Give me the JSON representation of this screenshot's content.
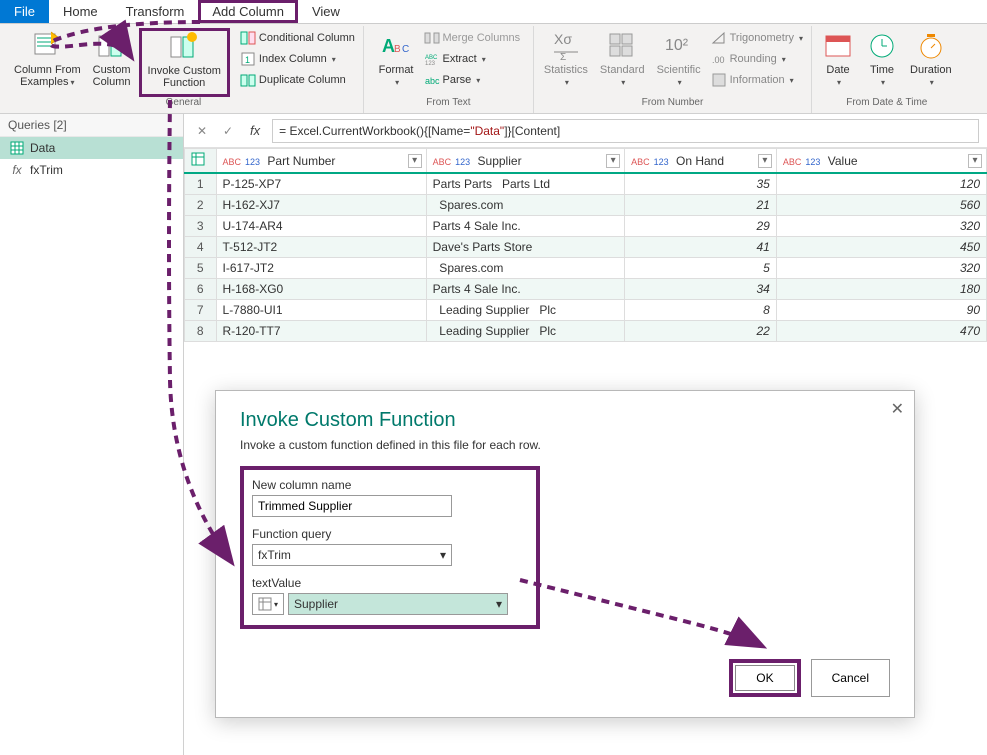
{
  "menu": {
    "file": "File",
    "items": [
      "Home",
      "Transform",
      "Add Column",
      "View"
    ]
  },
  "ribbon": {
    "general": {
      "label": "General",
      "column_from_examples": "Column From\nExamples",
      "custom_column": "Custom\nColumn",
      "invoke_custom_function": "Invoke Custom\nFunction",
      "conditional_column": "Conditional Column",
      "index_column": "Index Column",
      "duplicate_column": "Duplicate Column"
    },
    "from_text": {
      "label": "From Text",
      "format": "Format",
      "merge_columns": "Merge Columns",
      "extract": "Extract",
      "parse": "Parse"
    },
    "from_number": {
      "label": "From Number",
      "statistics": "Statistics",
      "standard": "Standard",
      "scientific": "Scientific",
      "trigonometry": "Trigonometry",
      "rounding": "Rounding",
      "information": "Information"
    },
    "from_datetime": {
      "label": "From Date & Time",
      "date": "Date",
      "time": "Time",
      "duration": "Duration"
    }
  },
  "queries": {
    "header": "Queries [2]",
    "items": [
      {
        "icon": "table",
        "label": "Data"
      },
      {
        "icon": "fx",
        "label": "fxTrim"
      }
    ]
  },
  "formula": {
    "prefix": "= Excel.CurrentWorkbook(){[Name=",
    "string": "\"Data\"",
    "suffix": "]}[Content]"
  },
  "grid": {
    "columns": [
      {
        "type": "ABC123",
        "name": "Part Number"
      },
      {
        "type": "ABC123",
        "name": "Supplier"
      },
      {
        "type": "ABC123",
        "name": "On Hand"
      },
      {
        "type": "ABC123",
        "name": "Value"
      }
    ],
    "rows": [
      {
        "n": 1,
        "part": "P-125-XP7",
        "supplier": "Parts Parts   Parts Ltd",
        "onhand": "35",
        "value": "120"
      },
      {
        "n": 2,
        "part": "H-162-XJ7",
        "supplier": "  Spares.com",
        "onhand": "21",
        "value": "560"
      },
      {
        "n": 3,
        "part": "U-174-AR4",
        "supplier": "Parts 4 Sale Inc.",
        "onhand": "29",
        "value": "320"
      },
      {
        "n": 4,
        "part": "T-512-JT2",
        "supplier": "Dave's Parts Store",
        "onhand": "41",
        "value": "450"
      },
      {
        "n": 5,
        "part": "I-617-JT2",
        "supplier": "  Spares.com",
        "onhand": "5",
        "value": "320"
      },
      {
        "n": 6,
        "part": "H-168-XG0",
        "supplier": "Parts 4 Sale Inc.",
        "onhand": "34",
        "value": "180"
      },
      {
        "n": 7,
        "part": "L-7880-UI1",
        "supplier": "  Leading Supplier   Plc",
        "onhand": "8",
        "value": "90"
      },
      {
        "n": 8,
        "part": "R-120-TT7",
        "supplier": "  Leading Supplier   Plc",
        "onhand": "22",
        "value": "470"
      }
    ]
  },
  "dialog": {
    "title": "Invoke Custom Function",
    "description": "Invoke a custom function defined in this file for each row.",
    "new_column_label": "New column name",
    "new_column_value": "Trimmed Supplier",
    "function_query_label": "Function query",
    "function_query_value": "fxTrim",
    "text_value_label": "textValue",
    "text_value_dropdown": "Supplier",
    "ok": "OK",
    "cancel": "Cancel"
  }
}
